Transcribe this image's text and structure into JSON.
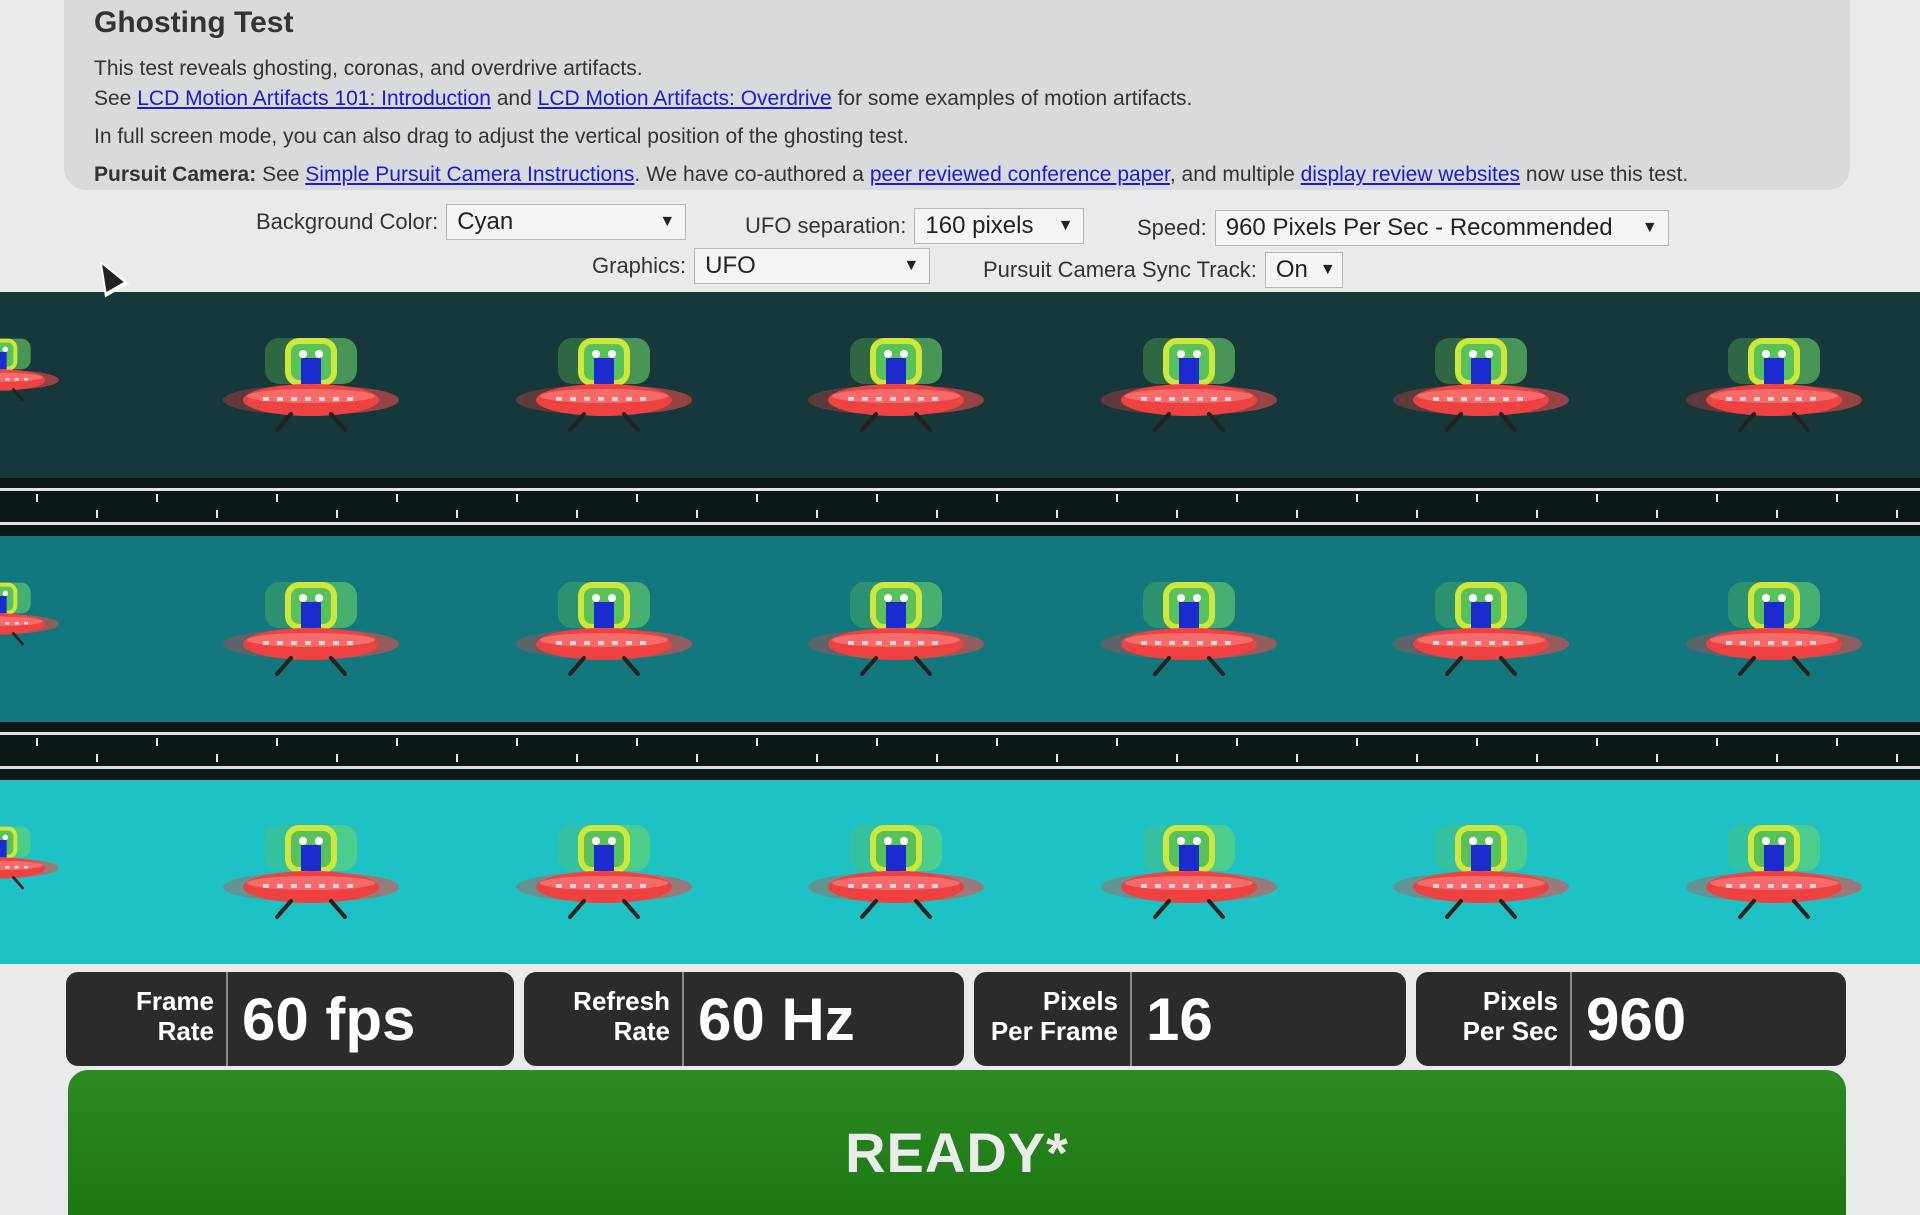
{
  "info": {
    "title": "Ghosting Test",
    "line1": "This test reveals ghosting, coronas, and overdrive artifacts.",
    "line2_prefix": "See",
    "link_intro": "LCD Motion Artifacts 101: Introduction",
    "line2_and": "and",
    "link_overdrive": "LCD Motion Artifacts: Overdrive",
    "line2_suffix": "for some examples of motion artifacts.",
    "line3": "In full screen mode, you can also drag to adjust the vertical position of the ghosting test.",
    "pursuit_label": "Pursuit Camera:",
    "pursuit_see": "See",
    "link_pursuit": "Simple Pursuit Camera Instructions",
    "pursuit_mid": ". We have co-authored a",
    "link_paper": "peer reviewed conference paper",
    "pursuit_mid2": ", and multiple",
    "link_review": "display review websites",
    "pursuit_suffix": "now use this test."
  },
  "controls": {
    "background_label": "Background Color:",
    "background_value": "Cyan",
    "separation_label": "UFO separation:",
    "separation_value": "160 pixels",
    "speed_label": "Speed:",
    "speed_value": "960 Pixels Per Sec - Recommended",
    "graphics_label": "Graphics:",
    "graphics_value": "UFO",
    "sync_label": "Pursuit Camera Sync Track:",
    "sync_value": "On",
    "arrow_glyph": "▼"
  },
  "lanes": [
    {
      "name": "dark-lane",
      "color": "#17383a"
    },
    {
      "name": "medium-lane",
      "color": "#13787e"
    },
    {
      "name": "light-lane",
      "color": "#1fc2c4"
    }
  ],
  "stats": [
    {
      "label_1": "Frame",
      "label_2": "Rate",
      "value": "60 fps"
    },
    {
      "label_1": "Refresh",
      "label_2": "Rate",
      "value": "60 Hz"
    },
    {
      "label_1": "Pixels",
      "label_2": "Per Frame",
      "value": "16"
    },
    {
      "label_1": "Pixels",
      "label_2": "Per Sec",
      "value": "960"
    }
  ],
  "status": {
    "text": "READY*"
  },
  "icons": {
    "ufo": "ufo-icon",
    "cursor": "mouse-cursor-icon"
  }
}
